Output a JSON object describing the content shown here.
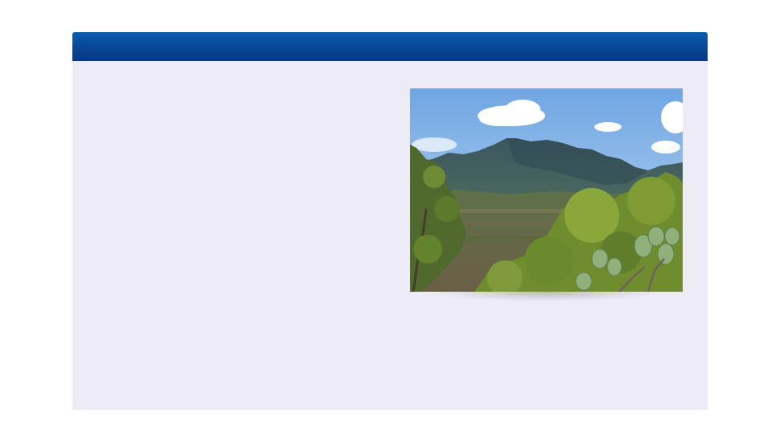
{
  "header": {
    "title": ""
  },
  "photo": {
    "subject": "mountain-landscape",
    "colors": {
      "sky_top": "#7fb0e6",
      "sky_bottom": "#bcd6f0",
      "mountain": "#3d5b64",
      "valley": "#6b6a4c",
      "foliage": "#6f8c2e"
    }
  },
  "colors": {
    "page_background": "#ffffff",
    "panel_background": "#edecf6",
    "header_top": "#0a5fae",
    "header_bottom": "#063a84"
  }
}
